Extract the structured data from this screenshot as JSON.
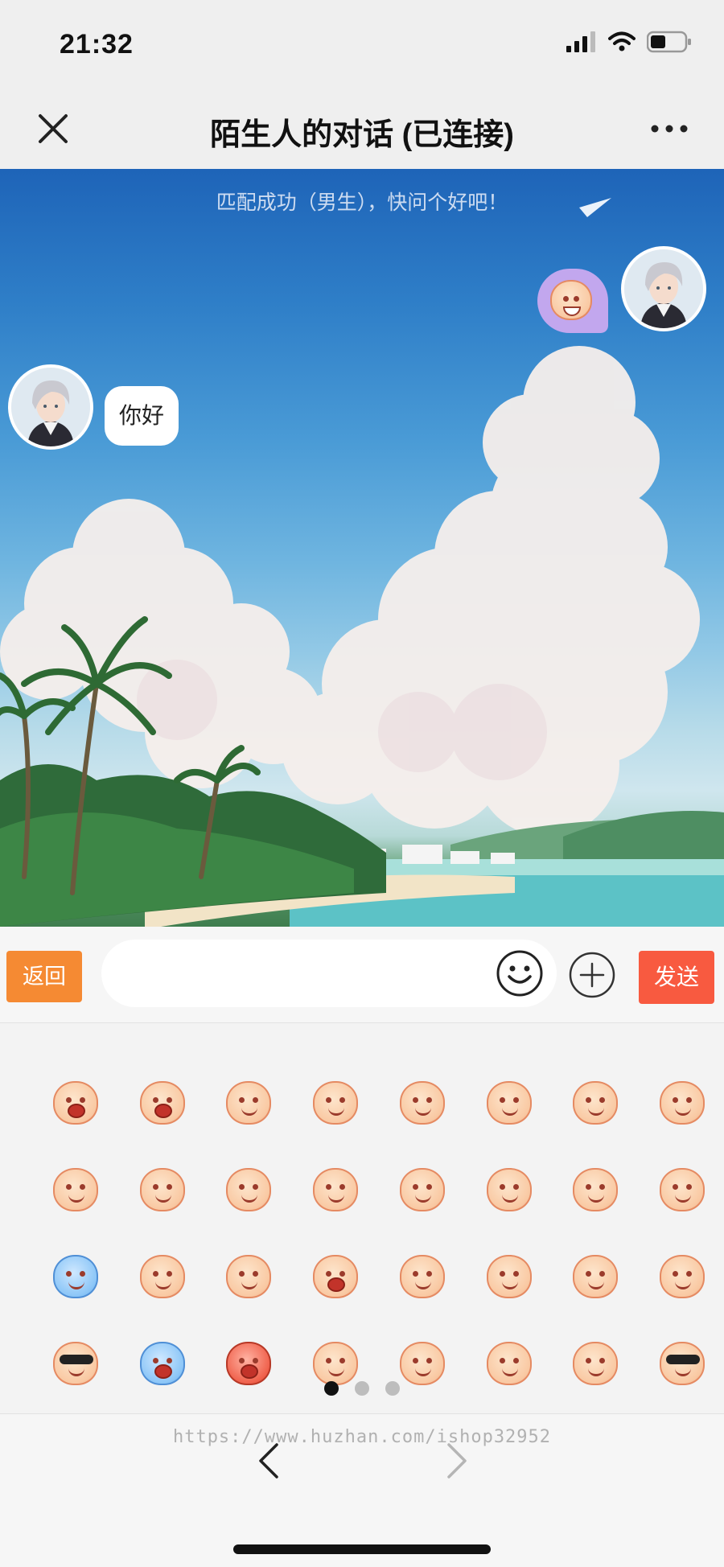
{
  "status_bar": {
    "time": "21:32"
  },
  "header": {
    "title": "陌生人的对话 (已连接)"
  },
  "chat": {
    "system_message": "匹配成功（男生），快问个好吧！",
    "messages": [
      {
        "side": "right",
        "type": "sticker",
        "sticker": "grin-face"
      },
      {
        "side": "left",
        "type": "text",
        "text": "你好"
      }
    ]
  },
  "input_bar": {
    "back_label": "返回",
    "send_label": "发送",
    "input_value": "",
    "input_placeholder": ""
  },
  "emoji_panel": {
    "emojis": [
      "laugh-cry",
      "big-laugh",
      "grin",
      "cover-mouth",
      "shy-smile",
      "smirk",
      "kiss",
      "embarrassed",
      "thinking",
      "relaxed",
      "sly",
      "wink-tongue",
      "question",
      "blush",
      "chubby-smile",
      "sweat",
      "cold-blue",
      "calm",
      "grimace",
      "yawn",
      "doubt",
      "smile",
      "cover-eyes",
      "facepalm-cry",
      "cool-shades",
      "shocked",
      "angry",
      "cry",
      "tearful",
      "pleading",
      "heart-eyes",
      "sunglasses-cigar"
    ],
    "pages": 3,
    "current_page": 1
  },
  "browser_bar": {
    "watermark": "https://www.huzhan.com/ishop32952"
  },
  "colors": {
    "back_button": "#f58a33",
    "send_button": "#f85a40",
    "sticker_bubble": "#c2a7ee"
  }
}
